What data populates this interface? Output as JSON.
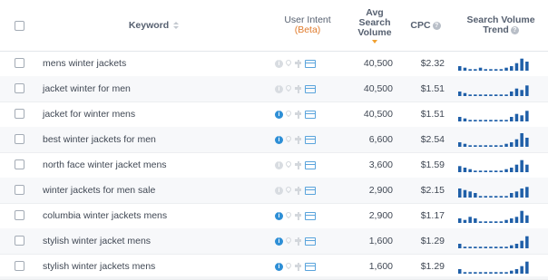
{
  "header": {
    "keyword": "Keyword",
    "user_intent_line1": "User Intent",
    "user_intent_line2": "(Beta)",
    "volume_line1": "Avg",
    "volume_line2": "Search",
    "volume_line3": "Volume",
    "cpc": "CPC",
    "trend_line1": "Search Volume",
    "trend_line2": "Trend"
  },
  "rows": [
    {
      "keyword": "mens winter jackets",
      "info": false,
      "volume": "40,500",
      "cpc": "$2.32",
      "trend": [
        3,
        2,
        1,
        1,
        2,
        1,
        1,
        1,
        1,
        2,
        3,
        5,
        8,
        6
      ]
    },
    {
      "keyword": "jacket winter for men",
      "info": false,
      "volume": "40,500",
      "cpc": "$1.51",
      "trend": [
        3,
        2,
        1,
        1,
        1,
        1,
        1,
        1,
        1,
        1,
        3,
        5,
        4,
        7
      ]
    },
    {
      "keyword": "jacket for winter mens",
      "info": true,
      "volume": "40,500",
      "cpc": "$1.51",
      "trend": [
        3,
        2,
        1,
        1,
        1,
        1,
        1,
        1,
        1,
        1,
        3,
        5,
        4,
        7
      ]
    },
    {
      "keyword": "best winter jackets for men",
      "info": true,
      "volume": "6,600",
      "cpc": "$2.54",
      "trend": [
        3,
        2,
        1,
        1,
        1,
        1,
        1,
        1,
        1,
        2,
        3,
        5,
        9,
        6
      ]
    },
    {
      "keyword": "north face winter jacket mens",
      "info": false,
      "volume": "3,600",
      "cpc": "$1.59",
      "trend": [
        4,
        3,
        2,
        1,
        1,
        1,
        1,
        1,
        1,
        2,
        3,
        5,
        8,
        5
      ]
    },
    {
      "keyword": "winter jackets for men sale",
      "info": false,
      "volume": "2,900",
      "cpc": "$2.15",
      "trend": [
        6,
        5,
        4,
        3,
        1,
        1,
        1,
        1,
        1,
        1,
        3,
        4,
        6,
        7
      ]
    },
    {
      "keyword": "columbia winter jackets mens",
      "info": true,
      "volume": "2,900",
      "cpc": "$1.17",
      "trend": [
        3,
        2,
        4,
        3,
        1,
        1,
        1,
        1,
        1,
        2,
        3,
        4,
        8,
        5
      ]
    },
    {
      "keyword": "stylish winter jacket mens",
      "info": true,
      "volume": "1,600",
      "cpc": "$1.29",
      "trend": [
        3,
        1,
        1,
        1,
        1,
        1,
        1,
        1,
        1,
        1,
        2,
        3,
        5,
        8
      ]
    },
    {
      "keyword": "stylish winter jackets mens",
      "info": true,
      "volume": "1,600",
      "cpc": "$1.29",
      "trend": [
        3,
        1,
        1,
        1,
        1,
        1,
        1,
        1,
        1,
        1,
        2,
        3,
        5,
        8
      ]
    }
  ],
  "colors": {
    "trend_bar": "#1f5fa8",
    "intent_active": "#2e8fd6",
    "beta": "#e07b2c"
  }
}
